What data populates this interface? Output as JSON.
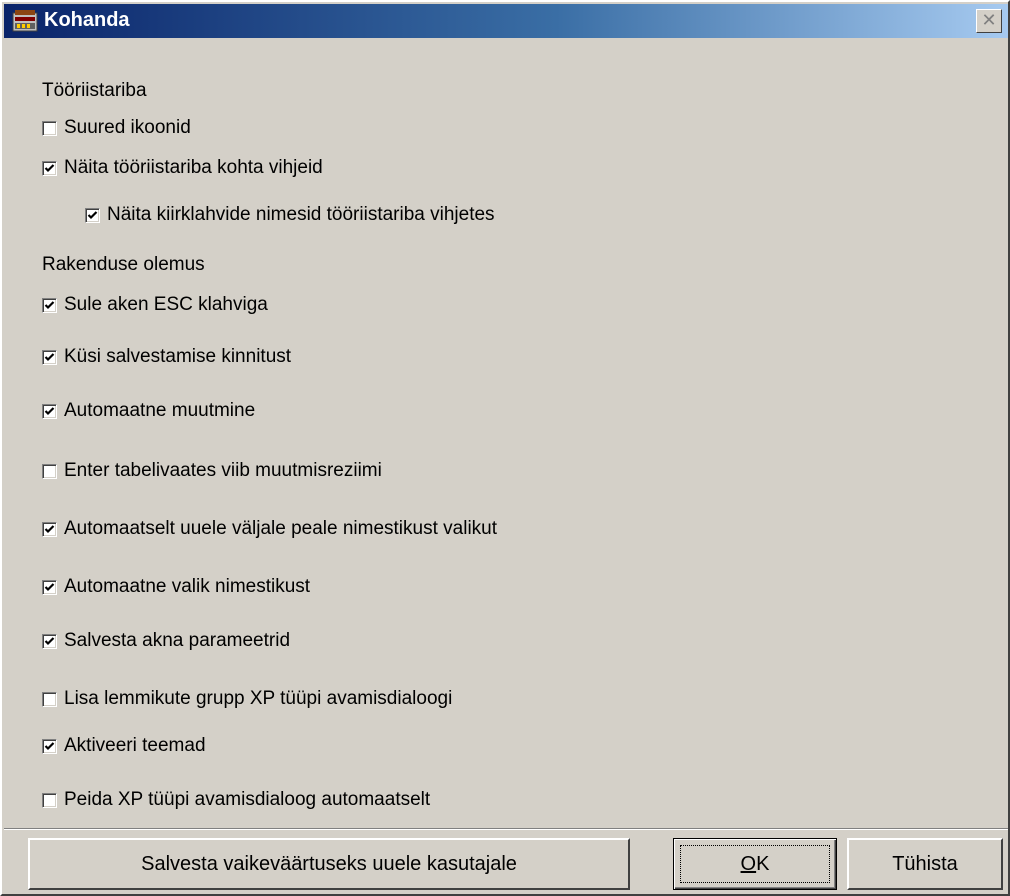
{
  "window": {
    "title": "Kohanda",
    "close_glyph": "✕"
  },
  "groups": {
    "toolbar_label": "Tööriistariba",
    "app_label": "Rakenduse olemus"
  },
  "options": [
    {
      "label": "Suured ikoonid",
      "checked": false
    },
    {
      "label": "Näita tööriistariba kohta vihjeid",
      "checked": true
    },
    {
      "label": "Näita kiirklahvide nimesid tööriistariba vihjetes",
      "checked": true
    },
    {
      "label": "Sule aken ESC klahviga",
      "checked": true
    },
    {
      "label": "Küsi salvestamise kinnitust",
      "checked": true
    },
    {
      "label": "Automaatne muutmine",
      "checked": true
    },
    {
      "label": "Enter tabelivaates viib muutmisreziimi",
      "checked": false
    },
    {
      "label": "Automaatselt uuele väljale peale nimestikust valikut",
      "checked": true
    },
    {
      "label": "Automaatne valik nimestikust",
      "checked": true
    },
    {
      "label": "Salvesta akna parameetrid",
      "checked": true
    },
    {
      "label": "Lisa lemmikute grupp XP tüüpi avamisdialoogi",
      "checked": false
    },
    {
      "label": "Aktiveeri teemad",
      "checked": true
    },
    {
      "label": "Peida XP tüüpi avamisdialoog automaatselt",
      "checked": false
    }
  ],
  "buttons": {
    "save_default": "Salvesta vaikeväärtuseks uuele kasutajale",
    "ok_mnemonic": "O",
    "ok_rest": "K",
    "cancel": "Tühista"
  },
  "colors": {
    "title_start": "#0a246a",
    "title_end": "#a6caf0",
    "face": "#d4d0c8"
  }
}
